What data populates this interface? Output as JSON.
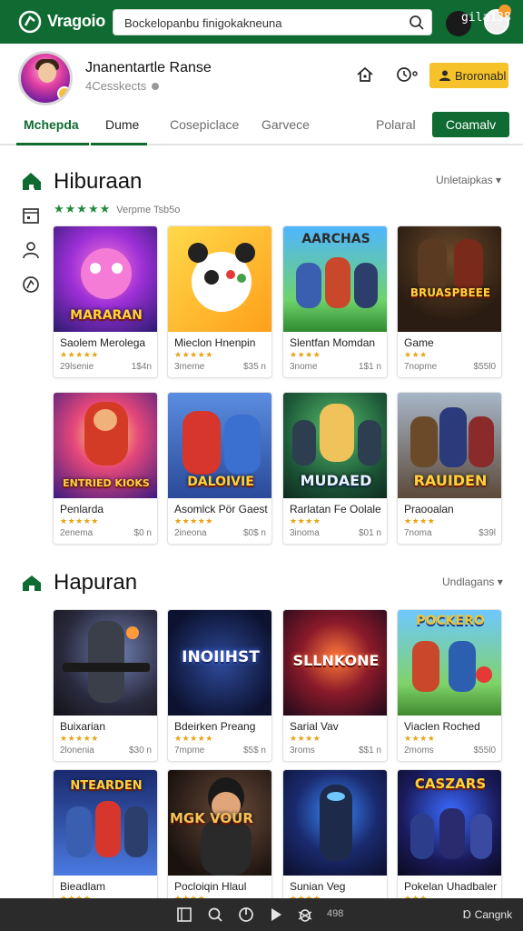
{
  "topbar": {
    "app_name": "Vragoio",
    "search_text": "Bockelopanbu finigokakneuna",
    "username": "gila138",
    "colors": {
      "bar": "#0f6b32",
      "badge": "#f39a2b"
    }
  },
  "profile": {
    "name": "Jnanentartle Ranse",
    "subtitle": "4Cesskects",
    "gold_button": "Broronabl",
    "icons": [
      "house-icon",
      "clock-icon",
      "user-icon"
    ]
  },
  "tabs": {
    "items": [
      "Mchepda",
      "Dume",
      "Cosepiclace",
      "Garvece",
      "Polaral"
    ],
    "active_index": 1,
    "button": "Coamalv"
  },
  "sidebar": {
    "icons": [
      "home-icon",
      "calendar-icon",
      "user-icon",
      "support-icon"
    ]
  },
  "sections": [
    {
      "title": "Hiburaan",
      "dropdown": "Unletaipkas",
      "rating_text": "Verpme Tsb5o",
      "rows": [
        [
          {
            "art_text": "MARARAN",
            "name": "Saolem Merolega",
            "meta": "29lsenie",
            "price": "1$4n"
          },
          {
            "art_text": "",
            "name": "Mieclon Hnenpin",
            "meta": "3meme",
            "price": "$35 n"
          },
          {
            "art_text": "AARCHAS",
            "name": "Slentfan Momdan",
            "meta": "3nome",
            "price": "1$1 n"
          },
          {
            "art_text": "BRUASPBEEE",
            "name": "Game",
            "meta": "7nopme",
            "price": "$55l0"
          }
        ],
        [
          {
            "art_text": "ENTRIED KIOKS",
            "name": "Penlarda",
            "meta": "2enema",
            "price": "$0 n"
          },
          {
            "art_text": "DALOIVIE",
            "name": "Asomlck Pör Gaest",
            "meta": "2ineona",
            "price": "$0$ n"
          },
          {
            "art_text": "MUDAED",
            "name": "Rarlatan Fe Oolale",
            "meta": "3inoma",
            "price": "$01 n"
          },
          {
            "art_text": "RAUIDEN",
            "name": "Praooalan",
            "meta": "7noma",
            "price": "$39l"
          }
        ]
      ]
    },
    {
      "title": "Hapuran",
      "dropdown": "Undlagans",
      "rows": [
        [
          {
            "art_text": "",
            "name": "Buixarian",
            "meta": "2lonenia",
            "price": "$30 n"
          },
          {
            "art_text": "INOIIHST",
            "name": "Bdeirken Preang",
            "meta": "7mpme",
            "price": "$5$ n"
          },
          {
            "art_text": "SLLNKONE",
            "name": "Sarial Vav",
            "meta": "3roms",
            "price": "$$1 n"
          },
          {
            "art_text": "POCKERO",
            "name": "Viaclen Roched",
            "meta": "2moms",
            "price": "$55l0"
          }
        ],
        [
          {
            "art_text": "NTEARDEN",
            "name": "Bieadlam",
            "meta": "",
            "price": ""
          },
          {
            "art_text": "MGK VOUR",
            "name": "Pocloiqin Hlaul",
            "meta": "",
            "price": ""
          },
          {
            "art_text": "",
            "name": "Sunian Veg",
            "meta": "",
            "price": ""
          },
          {
            "art_text": "CASZARS",
            "name": "Pokelan Uhadbaler",
            "meta": "",
            "price": ""
          }
        ]
      ]
    }
  ],
  "bottombar": {
    "icons": [
      "window-icon",
      "search-icon",
      "power-icon",
      "play-icon",
      "bug-icon"
    ],
    "number": "498",
    "right_label": "Ɒ Cangnk"
  }
}
